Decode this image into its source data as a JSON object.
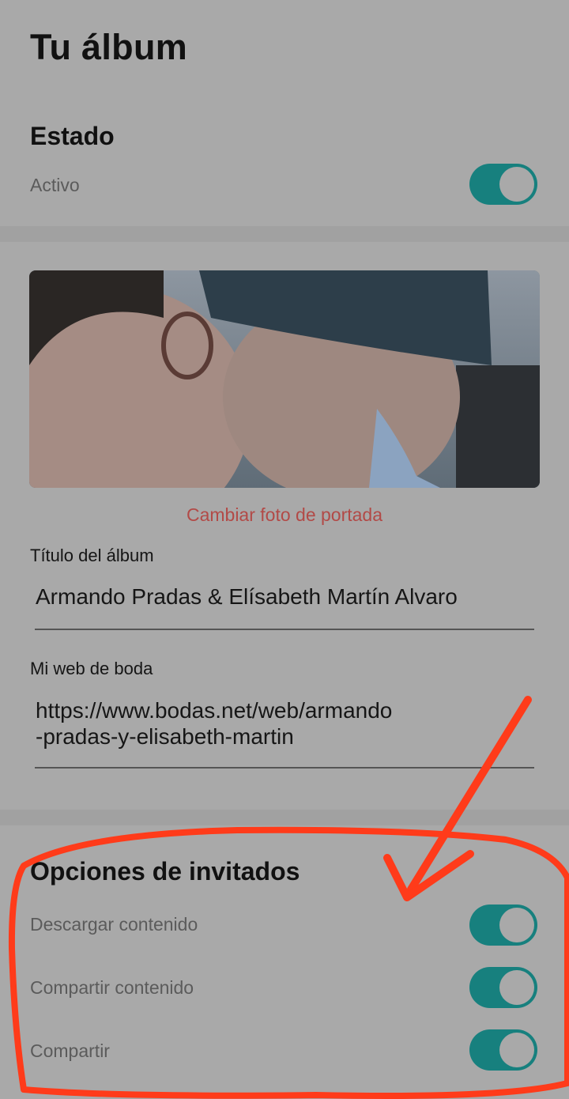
{
  "header": {
    "title": "Tu álbum"
  },
  "status": {
    "title": "Estado",
    "label": "Activo",
    "enabled": true
  },
  "cover": {
    "image_icon": "couple-photo",
    "change_link": "Cambiar foto de portada"
  },
  "album_title": {
    "label": "Título del álbum",
    "value": "Armando Pradas & Elísabeth Martín Alvaro"
  },
  "wedding_web": {
    "label": "Mi web de boda",
    "value": "https://www.bodas.net/web/armando\n-pradas-y-elisabeth-martin"
  },
  "guest_options": {
    "title": "Opciones de invitados",
    "items": [
      {
        "label": "Descargar contenido",
        "enabled": true
      },
      {
        "label": "Compartir contenido",
        "enabled": true
      },
      {
        "label": "Compartir",
        "enabled": true
      }
    ]
  },
  "colors": {
    "toggle_on": "#17807e",
    "link": "#b24a47",
    "annotation": "#ff3b1a"
  }
}
